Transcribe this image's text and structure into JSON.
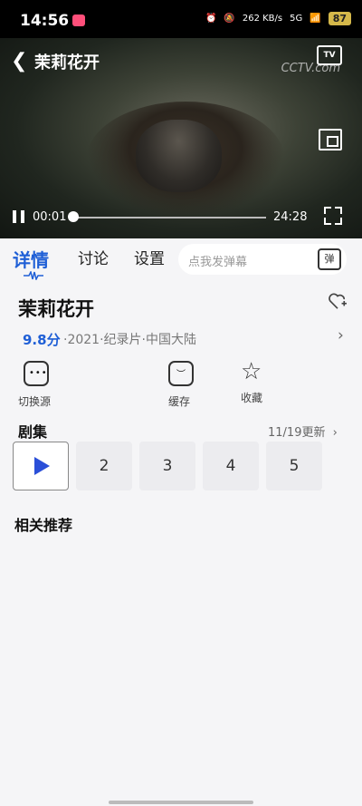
{
  "status_bar": {
    "time": "14:56",
    "network_speed": "262 KB/s",
    "network_type": "5G",
    "battery": "87"
  },
  "player": {
    "title": "茉莉花开",
    "watermark": "CCTV.com",
    "tv_icon_label": "TV",
    "current_time": "00:01",
    "duration": "24:28",
    "progress": 0.0
  },
  "tabs": [
    {
      "label": "详情"
    },
    {
      "label": "讨论"
    },
    {
      "label": "设置"
    }
  ],
  "danmu": {
    "placeholder": "点我发弹幕",
    "button_label": "弹"
  },
  "show": {
    "title": "茉莉花开",
    "score": "9.8分",
    "meta": "·2021·纪录片·中国大陆"
  },
  "actions": [
    {
      "label": "切换源"
    },
    {
      "label": "缓存"
    },
    {
      "label": "收藏"
    }
  ],
  "episodes": {
    "heading": "剧集",
    "update": "11/19更新",
    "items": [
      "2",
      "3",
      "4",
      "5"
    ]
  },
  "recommend": {
    "heading": "相关推荐"
  }
}
